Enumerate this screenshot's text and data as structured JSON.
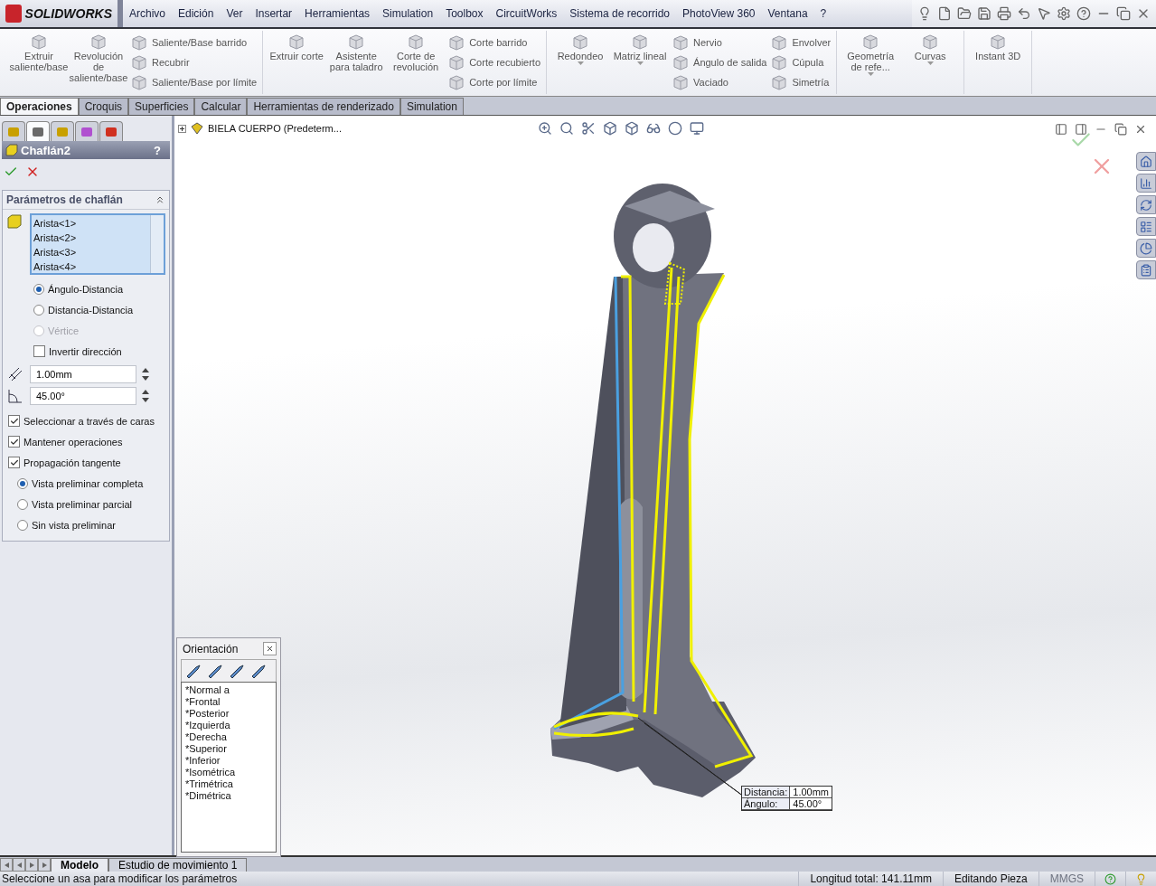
{
  "app": {
    "logo": "SOLIDWORKS"
  },
  "menu": [
    "Archivo",
    "Edición",
    "Ver",
    "Insertar",
    "Herramientas",
    "Simulation",
    "Toolbox",
    "CircuitWorks",
    "Sistema de recorrido",
    "PhotoView 360",
    "Ventana",
    "?"
  ],
  "ribbon": {
    "groups": [
      {
        "tools": [
          {
            "kind": "big",
            "label": "Extruir saliente/base",
            "dropdown": false
          },
          {
            "kind": "big",
            "label": "Revolución de saliente/base",
            "dropdown": false
          },
          {
            "kind": "stack",
            "items": [
              "Saliente/Base barrido",
              "Recubrir",
              "Saliente/Base por límite"
            ]
          }
        ]
      },
      {
        "tools": [
          {
            "kind": "big",
            "label": "Extruir corte",
            "dropdown": false
          },
          {
            "kind": "big",
            "label": "Asistente para taladro",
            "dropdown": false
          },
          {
            "kind": "big",
            "label": "Corte de revolución",
            "dropdown": false
          },
          {
            "kind": "stack",
            "items": [
              "Corte barrido",
              "Corte recubierto",
              "Corte por límite"
            ]
          }
        ]
      },
      {
        "tools": [
          {
            "kind": "big",
            "label": "Redondeo",
            "dropdown": true
          },
          {
            "kind": "big",
            "label": "Matriz lineal",
            "dropdown": true
          },
          {
            "kind": "stack",
            "items": [
              "Nervio",
              "Ángulo de salida",
              "Vaciado"
            ]
          },
          {
            "kind": "stack",
            "items": [
              "Envolver",
              "Cúpula",
              "Simetría"
            ]
          }
        ]
      },
      {
        "tools": [
          {
            "kind": "big",
            "label": "Geometría de refe...",
            "dropdown": true
          },
          {
            "kind": "big",
            "label": "Curvas",
            "dropdown": true
          }
        ]
      },
      {
        "tools": [
          {
            "kind": "big",
            "label": "Instant 3D",
            "dropdown": false
          }
        ]
      }
    ]
  },
  "command_tabs": [
    {
      "label": "Operaciones",
      "selected": true
    },
    {
      "label": "Croquis",
      "selected": false
    },
    {
      "label": "Superficies",
      "selected": false
    },
    {
      "label": "Calcular",
      "selected": false
    },
    {
      "label": "Herramientas de renderizado",
      "selected": false
    },
    {
      "label": "Simulation",
      "selected": false
    }
  ],
  "panel_tabs": [
    {
      "selected": false
    },
    {
      "selected": true
    },
    {
      "selected": false
    },
    {
      "selected": false
    },
    {
      "selected": false
    }
  ],
  "property_manager": {
    "title": "Chaflán2",
    "help": "?",
    "section": "Parámetros de chaflán",
    "edges": [
      "Arista<1>",
      "Arista<2>",
      "Arista<3>",
      "Arista<4>"
    ],
    "mode_options": [
      {
        "label": "Ángulo-Distancia",
        "selected": true,
        "disabled": false
      },
      {
        "label": "Distancia-Distancia",
        "selected": false,
        "disabled": false
      },
      {
        "label": "Vértice",
        "selected": false,
        "disabled": true
      }
    ],
    "reverse": {
      "label": "Invertir dirección",
      "checked": false
    },
    "distance": {
      "value": "1.00mm"
    },
    "angle": {
      "value": "45.00°"
    },
    "options": [
      {
        "label": "Seleccionar a través de caras",
        "checked": true
      },
      {
        "label": "Mantener operaciones",
        "checked": true
      },
      {
        "label": "Propagación tangente",
        "checked": true
      }
    ],
    "preview_options": [
      {
        "label": "Vista preliminar completa",
        "selected": true
      },
      {
        "label": "Vista preliminar parcial",
        "selected": false
      },
      {
        "label": "Sin vista preliminar",
        "selected": false
      }
    ]
  },
  "tree": {
    "label": "BIELA CUERPO  (Predeterm...",
    "expanded": false
  },
  "orientation": {
    "title": "Orientación",
    "views": [
      "*Normal a",
      "*Frontal",
      "*Posterior",
      "*Izquierda",
      "*Derecha",
      "*Superior",
      "*Inferior",
      "*Isométrica",
      "*Trimétrica",
      "*Dimétrica"
    ]
  },
  "callout": {
    "rows": [
      {
        "label": "Distancia:",
        "value": "1.00mm"
      },
      {
        "label": "Ángulo:",
        "value": "45.00°"
      }
    ]
  },
  "bottom_tabs": [
    {
      "label": "Modelo",
      "selected": true
    },
    {
      "label": "Estudio de movimiento 1",
      "selected": false
    }
  ],
  "status_bar": {
    "message": "Seleccione un asa para modificar los parámetros",
    "length": "Longitud total: 141.11mm",
    "mode": "Editando Pieza",
    "units": "MMGS",
    "units_disabled": true
  }
}
